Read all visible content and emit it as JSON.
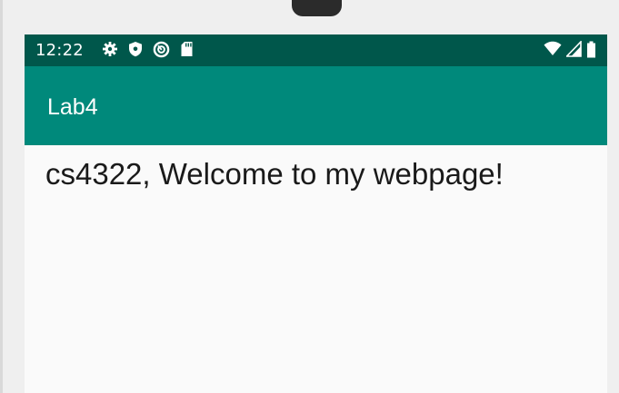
{
  "status_bar": {
    "time": "12:22",
    "left_icons": [
      "gear-icon",
      "shield-icon",
      "sync-icon",
      "sd-card-icon"
    ],
    "right_icons": [
      "wifi-icon",
      "cell-signal-icon",
      "battery-icon"
    ]
  },
  "app_bar": {
    "title": "Lab4"
  },
  "content": {
    "text": "cs4322, Welcome to my webpage!"
  },
  "colors": {
    "status_bar": "#00574b",
    "app_bar": "#00897b",
    "background": "#fafafa",
    "text": "#1a1a1a"
  }
}
